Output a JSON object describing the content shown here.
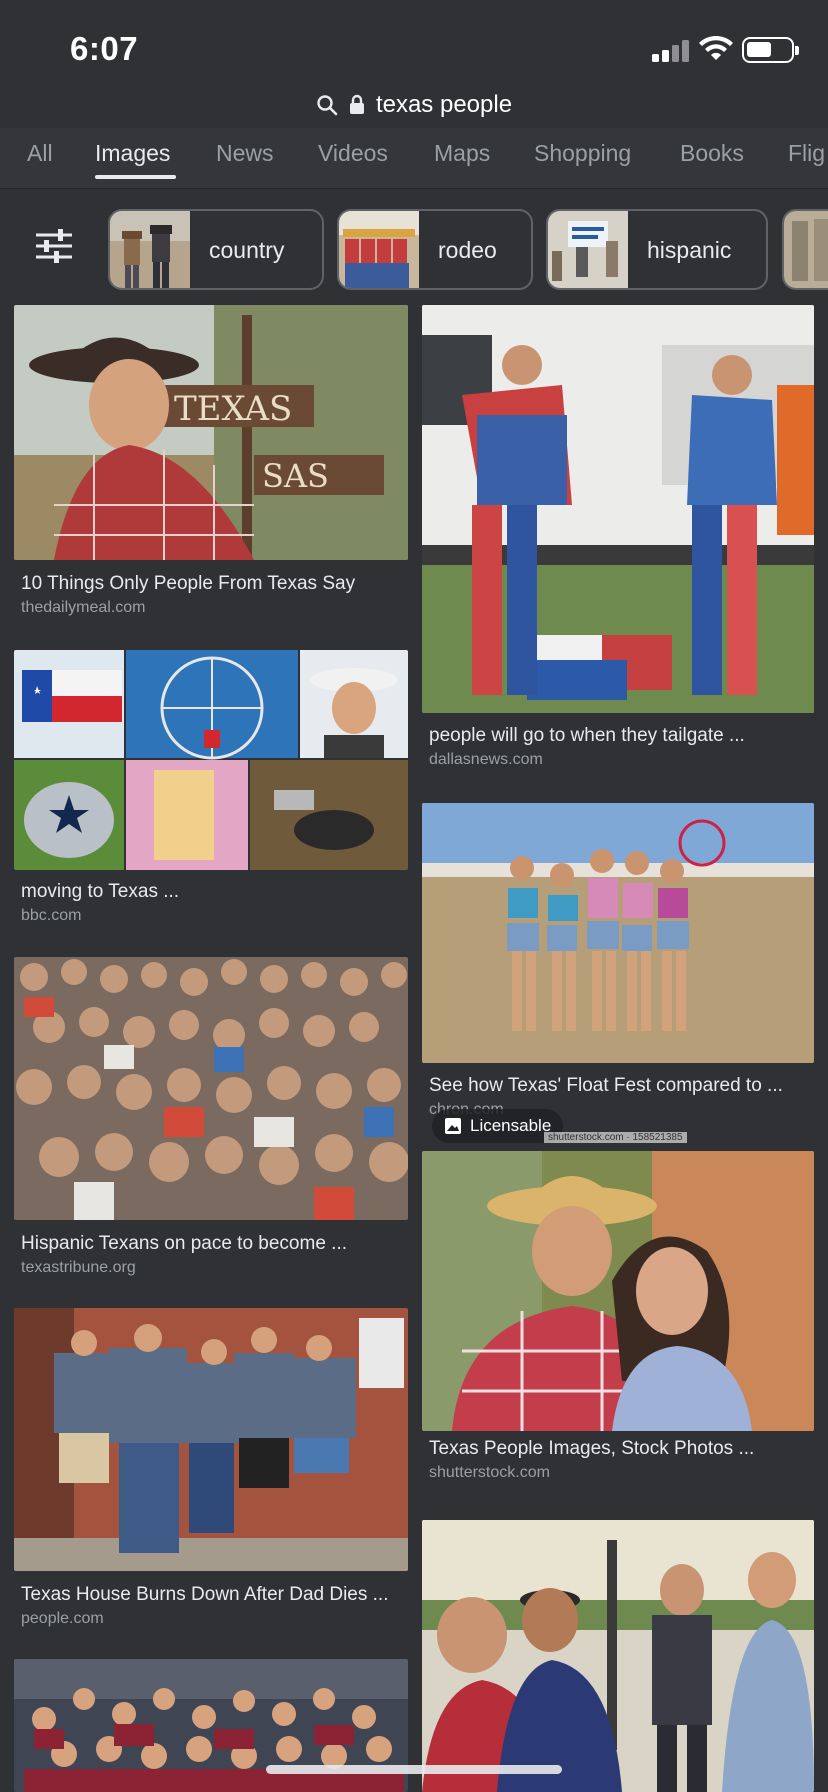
{
  "status_bar": {
    "time": "6:07",
    "battery_level_fraction": 0.5
  },
  "url_bar": {
    "url_text": "texas people"
  },
  "tabs": [
    {
      "label": "All",
      "active": false
    },
    {
      "label": "Images",
      "active": true
    },
    {
      "label": "News",
      "active": false
    },
    {
      "label": "Videos",
      "active": false
    },
    {
      "label": "Maps",
      "active": false
    },
    {
      "label": "Shopping",
      "active": false
    },
    {
      "label": "Books",
      "active": false
    },
    {
      "label": "Flig",
      "active": false
    }
  ],
  "chips": [
    {
      "label": "country"
    },
    {
      "label": "rodeo"
    },
    {
      "label": "hispanic"
    }
  ],
  "results_left": [
    {
      "title": "10 Things Only People From Texas Say",
      "source": "thedailymeal.com",
      "sign_text_1": "TEXAS",
      "sign_text_2": "SAS"
    },
    {
      "title": "moving to Texas ...",
      "source": "bbc.com"
    },
    {
      "title": "Hispanic Texans on pace to become ...",
      "source": "texastribune.org"
    },
    {
      "title": "Texas House Burns Down After Dad Dies ...",
      "source": "people.com"
    },
    {
      "title": "",
      "source": ""
    }
  ],
  "results_right": [
    {
      "title": "people will go to when they tailgate ...",
      "source": "dallasnews.com"
    },
    {
      "title": "See how Texas' Float Fest compared to ...",
      "source": "chron.com"
    },
    {
      "title": "Texas People Images, Stock Photos ...",
      "source": "shutterstock.com",
      "badge": "Licensable",
      "watermark": "shutterstock.com · 158521385"
    },
    {
      "title": "",
      "source": ""
    }
  ],
  "colors": {
    "background": "#303134",
    "tab_bar": "#35363a",
    "text_primary": "#e8eaed",
    "text_secondary": "#9aa0a6",
    "chip_border": "#5f6368"
  },
  "icons": [
    "search-icon",
    "lock-icon",
    "filter-sliders-icon",
    "image-icon",
    "wifi-icon",
    "signal-icon",
    "battery-icon"
  ]
}
